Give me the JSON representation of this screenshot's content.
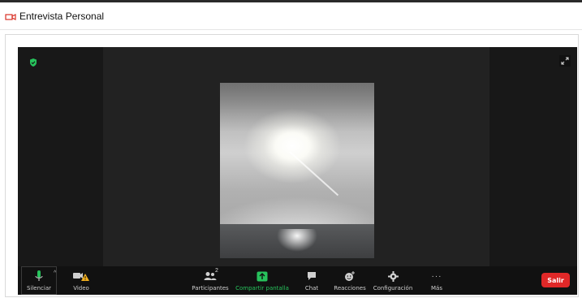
{
  "header": {
    "title": "Entrevista Personal",
    "icon": "video-camera-icon"
  },
  "meeting": {
    "security_icon": "shield-check-icon",
    "expand_icon": "expand-icon",
    "video_description_icon": "participant-video"
  },
  "toolbar": {
    "mute": {
      "label": "Silenciar",
      "icon": "microphone-icon"
    },
    "video": {
      "label": "Video",
      "icon": "video-camera-warning-icon"
    },
    "participants": {
      "label": "Participantes",
      "count": "2",
      "icon": "participants-icon"
    },
    "share": {
      "label": "Compartir pantalla",
      "icon": "share-screen-icon"
    },
    "chat": {
      "label": "Chat",
      "icon": "chat-icon"
    },
    "reactions": {
      "label": "Reacciones",
      "icon": "reactions-icon"
    },
    "settings": {
      "label": "Configuración",
      "icon": "gear-icon"
    },
    "more": {
      "label": "Más",
      "glyph": "···",
      "icon": "more-icon"
    },
    "exit": {
      "label": "Salir"
    }
  },
  "colors": {
    "accent_green": "#27c25c",
    "exit_red": "#e02828",
    "toolbar_bg": "#111111"
  }
}
